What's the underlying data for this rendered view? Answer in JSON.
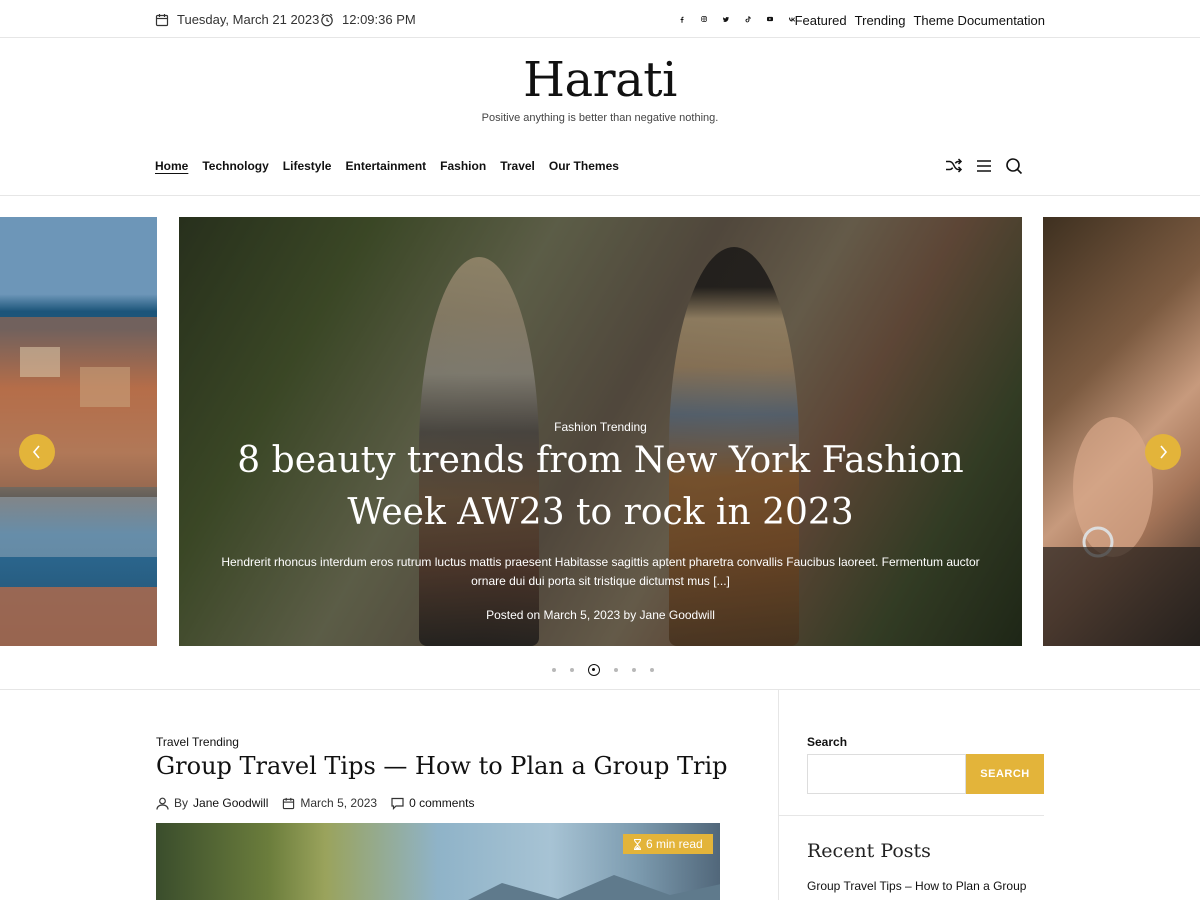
{
  "topbar": {
    "date": "Tuesday, March 21 2023",
    "time": "12:09:36 PM",
    "social_icons": [
      "facebook-icon",
      "instagram-icon",
      "twitter-icon",
      "tiktok-icon",
      "youtube-icon",
      "vk-icon"
    ],
    "links": [
      "Featured",
      "Trending",
      "Theme Documentation"
    ]
  },
  "site": {
    "title": "Harati",
    "tagline": "Positive anything is better than negative nothing."
  },
  "nav": {
    "items": [
      "Home",
      "Technology",
      "Lifestyle",
      "Entertainment",
      "Fashion",
      "Travel",
      "Our Themes"
    ],
    "active": "Home",
    "icons": [
      "shuffle-icon",
      "menu-icon",
      "search-icon"
    ]
  },
  "slider": {
    "category": "Fashion Trending",
    "title": "8 beauty trends from New York Fashion Week AW23 to rock in 2023",
    "excerpt": "Hendrerit rhoncus interdum eros rutrum luctus mattis praesent Habitasse sagittis aptent pharetra convallis Faucibus laoreet. Fermentum auctor ornare dui dui porta sit tristique dictumst mus [...]",
    "meta": "Posted on March 5, 2023 by Jane Goodwill",
    "dot_count": 6,
    "active_dot": 2
  },
  "post": {
    "category": "Travel Trending",
    "title": "Group Travel Tips — How to Plan a Group Trip",
    "by_label": "By",
    "author": "Jane Goodwill",
    "date": "March 5, 2023",
    "comments": "0 comments",
    "read_time": "6 min read"
  },
  "sidebar": {
    "search_label": "Search",
    "search_button": "SEARCH",
    "search_placeholder": "",
    "recent_heading": "Recent Posts",
    "recent_posts": [
      "Group Travel Tips – How to Plan a Group"
    ]
  },
  "colors": {
    "accent": "#e3b43a",
    "text": "#111111",
    "border": "#e6e6e6"
  }
}
